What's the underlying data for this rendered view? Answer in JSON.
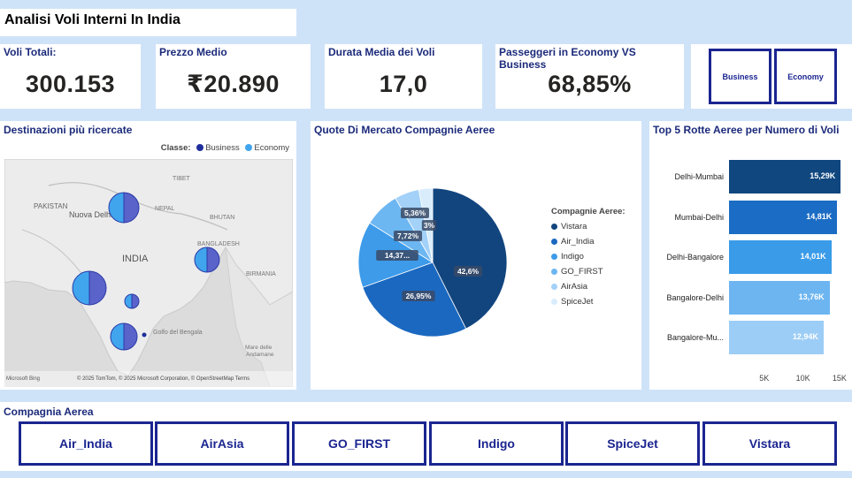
{
  "title": "Analisi Voli Interni In India",
  "kpis": [
    {
      "label": "Voli Totali:",
      "value": "300.153"
    },
    {
      "label": "Prezzo Medio",
      "value": "₹20.890"
    },
    {
      "label": "Durata Media dei Voli",
      "value": "17,0"
    },
    {
      "label": "Passeggeri in Economy VS Business",
      "value": "68,85%"
    }
  ],
  "class_slicer": [
    "Business",
    "Economy"
  ],
  "map": {
    "title": "Destinazioni più ricercate",
    "legend_title": "Classe:",
    "legend": [
      {
        "name": "Business",
        "color": "#1f2e9c"
      },
      {
        "name": "Economy",
        "color": "#41a5ee"
      }
    ],
    "labels": {
      "pakistan": "PAKISTAN",
      "delhi": "Nuova Delhi",
      "nepal": "NEPAL",
      "tibet": "TIBET",
      "bhutan": "BHUTAN",
      "bangladesh": "BANGLADESH",
      "india": "INDIA",
      "burma": "BIRMANIA",
      "gulf": "Golfo del Bengala",
      "sea1": "Mare delle",
      "sea2": "Andamane"
    },
    "attribution": "© 2025 TomTom, © 2025 Microsoft Corporation, © OpenStreetMap  Terms",
    "bing": "Microsoft Bing"
  },
  "pie": {
    "title": "Quote Di Mercato Compagnie Aeree",
    "legend_title": "Compagnie Aeree:",
    "slices": [
      {
        "name": "Vistara",
        "value": 42.6,
        "label": "42,6%",
        "color": "#12457e"
      },
      {
        "name": "Air_India",
        "value": 26.95,
        "label": "26,95%",
        "color": "#1b68c0"
      },
      {
        "name": "Indigo",
        "value": 14.37,
        "label": "14,37...",
        "color": "#3d9be9"
      },
      {
        "name": "GO_FIRST",
        "value": 7.72,
        "label": "7,72%",
        "color": "#6cb6f2"
      },
      {
        "name": "AirAsia",
        "value": 5.36,
        "label": "5,36%",
        "color": "#a3d1f8"
      },
      {
        "name": "SpiceJet",
        "value": 3.0,
        "label": "3%",
        "color": "#d8ecfc"
      }
    ]
  },
  "chart_data": {
    "type": "bar",
    "title": "Top 5 Rotte Aeree per Numero di Voli",
    "categories": [
      "Delhi-Mumbai",
      "Mumbai-Delhi",
      "Delhi-Bangalore",
      "Bangalore-Delhi",
      "Bangalore-Mu..."
    ],
    "values": [
      15290,
      14810,
      14010,
      13760,
      12940
    ],
    "value_labels": [
      "15,29K",
      "14,81K",
      "14,01K",
      "13,76K",
      "12,94K"
    ],
    "colors": [
      "#10477f",
      "#1b6cc4",
      "#3a9be8",
      "#6cb5f1",
      "#9ccdf6"
    ],
    "xlim": [
      0,
      15500
    ],
    "ticks": [
      {
        "v": 5000,
        "label": "5K"
      },
      {
        "v": 10000,
        "label": "10K"
      },
      {
        "v": 15000,
        "label": "15K"
      }
    ]
  },
  "airline_slicer": {
    "title": "Compagnia Aerea",
    "items": [
      "Air_India",
      "AirAsia",
      "GO_FIRST",
      "Indigo",
      "SpiceJet",
      "Vistara"
    ]
  }
}
